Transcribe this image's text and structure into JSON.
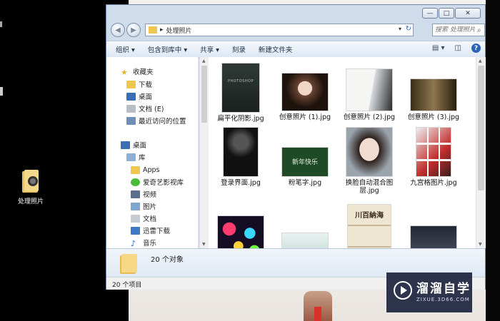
{
  "desktop": {
    "icon_label": "处理照片"
  },
  "window": {
    "controls": {
      "minimize": "—",
      "maximize": "□",
      "close": "✕"
    },
    "address": {
      "crumb_sep": "▸",
      "path": "处理照片",
      "dropdown": "▾",
      "refresh": "↻"
    },
    "search": {
      "placeholder": "搜索 处理照片"
    },
    "toolbar": {
      "organize": "组织 ▾",
      "include_in_library": "包含到库中 ▾",
      "share": "共享 ▾",
      "burn": "刻录",
      "new_folder": "新建文件夹",
      "view_icon": "view-options-icon",
      "preview_icon": "preview-pane-icon",
      "help": "?"
    },
    "nav": {
      "favorites": "收藏夹",
      "downloads": "下载",
      "desktop_fav": "桌面",
      "documents_e": "文档 (E)",
      "recent": "最近访问的位置",
      "desktop": "桌面",
      "library": "库",
      "apps": "Apps",
      "iqiyi": "爱奇艺影视库",
      "videos": "视频",
      "pictures": "图片",
      "docs": "文档",
      "xunlei": "迅雷下载",
      "music": "音乐"
    },
    "files": [
      {
        "name": "扁平化阴影.jpg",
        "thumb_text": "PHOTOSHOP"
      },
      {
        "name": "创意照片 (1).jpg"
      },
      {
        "name": "创意照片 (2).jpg"
      },
      {
        "name": "创意照片 (3).jpg"
      },
      {
        "name": "登录界面.jpg"
      },
      {
        "name": "粉笔字.jpg",
        "thumb_text": "新年快乐"
      },
      {
        "name": "换脸自动混合图层.jpg"
      },
      {
        "name": "九宫格图片.jpg"
      },
      {
        "name": ""
      },
      {
        "name": ""
      },
      {
        "name": "",
        "thumb_text": "川百納海"
      },
      {
        "name": ""
      }
    ],
    "details": {
      "count": "20 个对象"
    },
    "status": {
      "items": "20 个项目"
    }
  },
  "watermark": {
    "brand": "溜溜自学",
    "url": "ZIXUE.3D66.COM"
  },
  "colors": {
    "accent": "#2a63b8",
    "frame": "#cfdcec",
    "folder": "#f0c74e"
  }
}
